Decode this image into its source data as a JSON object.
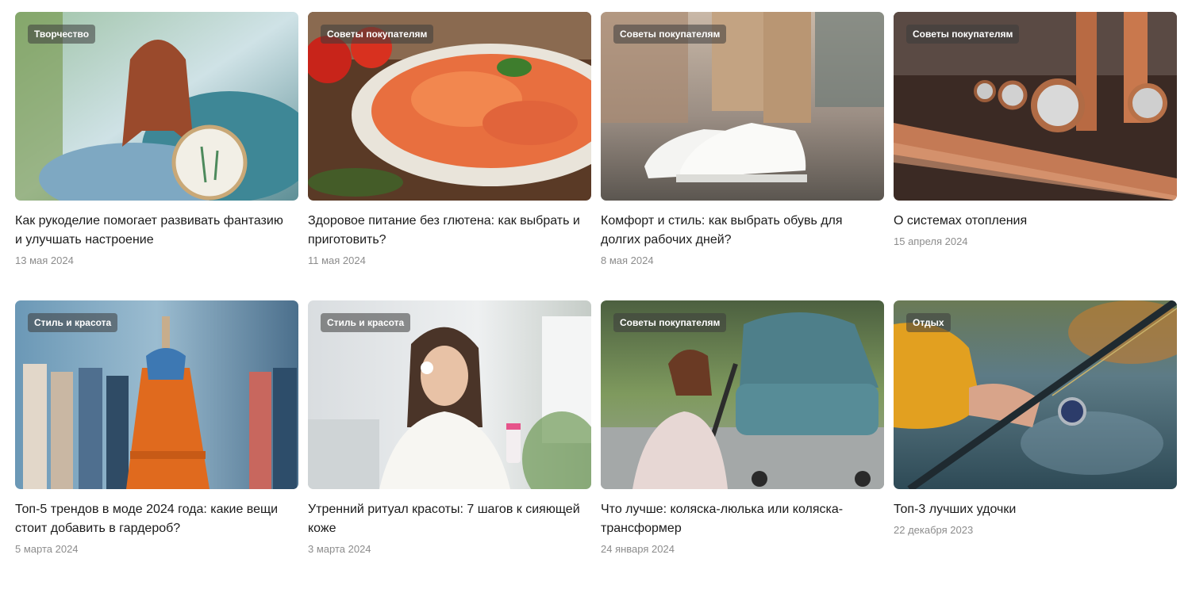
{
  "cards": [
    {
      "tag": "Творчество",
      "title": "Как рукоделие помогает развивать фантазию и улучшать настроение",
      "date": "13 мая 2024"
    },
    {
      "tag": "Советы покупателям",
      "title": "Здоровое питание без глютена: как выбрать и приготовить?",
      "date": "11 мая 2024"
    },
    {
      "tag": "Советы покупателям",
      "title": "Комфорт и стиль: как выбрать обувь для долгих рабочих дней?",
      "date": "8 мая 2024"
    },
    {
      "tag": "Советы покупателям",
      "title": "О системах отопления",
      "date": "15 апреля 2024"
    },
    {
      "tag": "Стиль и красота",
      "title": "Топ-5 трендов в моде 2024 года: какие вещи стоит добавить в гардероб?",
      "date": "5 марта 2024"
    },
    {
      "tag": "Стиль и красота",
      "title": "Утренний ритуал красоты: 7 шагов к сияющей коже",
      "date": "3 марта 2024"
    },
    {
      "tag": "Советы покупателям",
      "title": "Что лучше: коляска-люлька или коляска-трансформер",
      "date": "24 января 2024"
    },
    {
      "tag": "Отдых",
      "title": "Топ-3 лучших удочки",
      "date": "22 декабря 2023"
    }
  ]
}
